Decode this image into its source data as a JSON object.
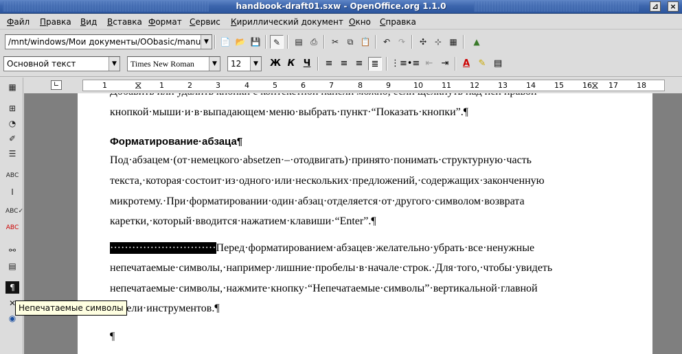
{
  "window": {
    "title": "handbook-draft01.sxw - OpenOffice.org 1.1.0"
  },
  "menu": [
    "Файл",
    "Правка",
    "Вид",
    "Вставка",
    "Формат",
    "Сервис",
    "Кириллический документ",
    "Окно",
    "Справка"
  ],
  "toolbar": {
    "path": "/mnt/windows/Мои документы/OObasic/manu"
  },
  "format": {
    "style": "Основной текст",
    "font": "Times New Roman",
    "size": "12"
  },
  "ruler": {
    "numbers": [
      "1",
      "1",
      "2",
      "3",
      "4",
      "5",
      "6",
      "7",
      "8",
      "9",
      "10",
      "11",
      "12",
      "13",
      "14",
      "15",
      "16",
      "17",
      "18"
    ]
  },
  "doc": {
    "line0": "Добавить или удалить кнопки с контекстной панели можно, если щелкнуть над ней правой",
    "line1": "кнопкой·мыши·и·в·выпадающем·меню·выбрать·пункт·“Показать·кнопки”.¶",
    "heading": "Форматирование·абзаца¶",
    "p1": [
      "Под·абзацем·(от·немецкого·absetzen·–·отодвигать)·принято·понимать·структурную·часть",
      "текста,·которая·состоит·из·одного·или·нескольких·предложений,·содержащих·законченную",
      "микротему.·При·форматировании·один·абзац·отделяется·от·другого·символом·возврата",
      "каретки,·который·вводится·нажатием·клавиши·“Enter”.¶"
    ],
    "p2_highlight": "·····························",
    "p2_first": "Перед·форматированием·абзацев·желательно·убрать·все·ненужные",
    "p2": [
      "непечатаемые·символы,·например·лишние·пробелы·в·начале·строк.·Для·того,·чтобы·увидеть",
      "непечатаемые·символы,·нажмите·кнопку·“Непечатаемые·символы”·вертикальной·главной",
      "панели·инструментов.¶"
    ],
    "empty_para": "¶"
  },
  "tooltip": "Непечатаемые символы",
  "icons": [
    "new-icon",
    "open-icon",
    "save-icon",
    "edit-icon",
    "pdf-icon",
    "print-icon",
    "cut-icon",
    "copy-icon",
    "paste-icon",
    "undo-icon",
    "navigator-icon",
    "gallery-icon"
  ]
}
